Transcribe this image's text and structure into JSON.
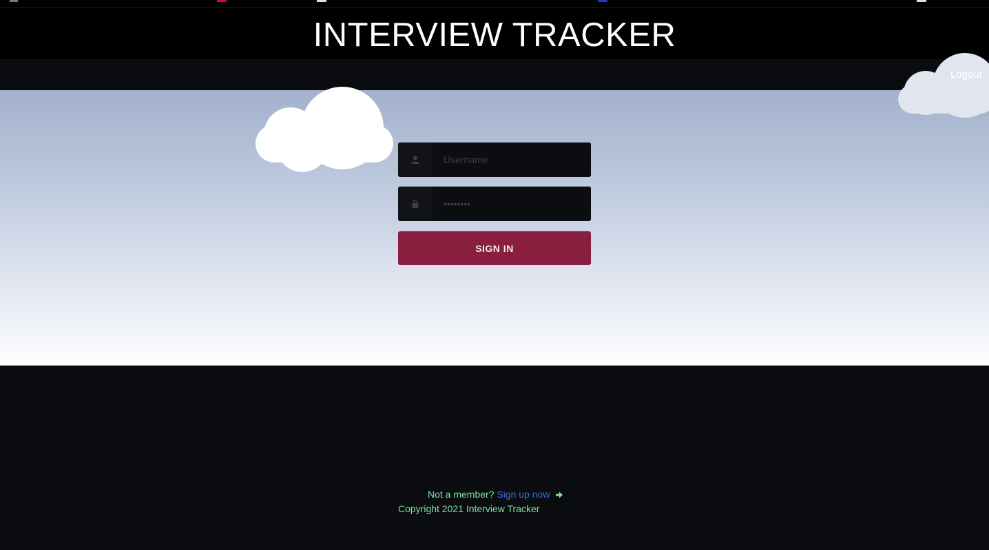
{
  "app": {
    "title": "INTERVIEW TRACKER"
  },
  "nav": {
    "logout_label": "Logout"
  },
  "login_form": {
    "username": {
      "placeholder": "Username",
      "icon": "user-icon"
    },
    "password": {
      "placeholder": "••••••••",
      "icon": "lock-icon"
    },
    "submit_label": "SIGN IN"
  },
  "footer": {
    "not_member_text": "Not a member?",
    "signup_link_label": "Sign up now",
    "signup_icon": "arrow-right-icon",
    "copyright": "Copyright 2021 Interview Tracker"
  },
  "colors": {
    "header_bg": "#000000",
    "page_bg": "#0a0c0f",
    "sky_top": "#a3b1cd",
    "sky_bottom": "#ffffff",
    "signin_button": "#8a1e3e",
    "footer_text": "#7ee2a6",
    "link": "#3a6fd8"
  }
}
